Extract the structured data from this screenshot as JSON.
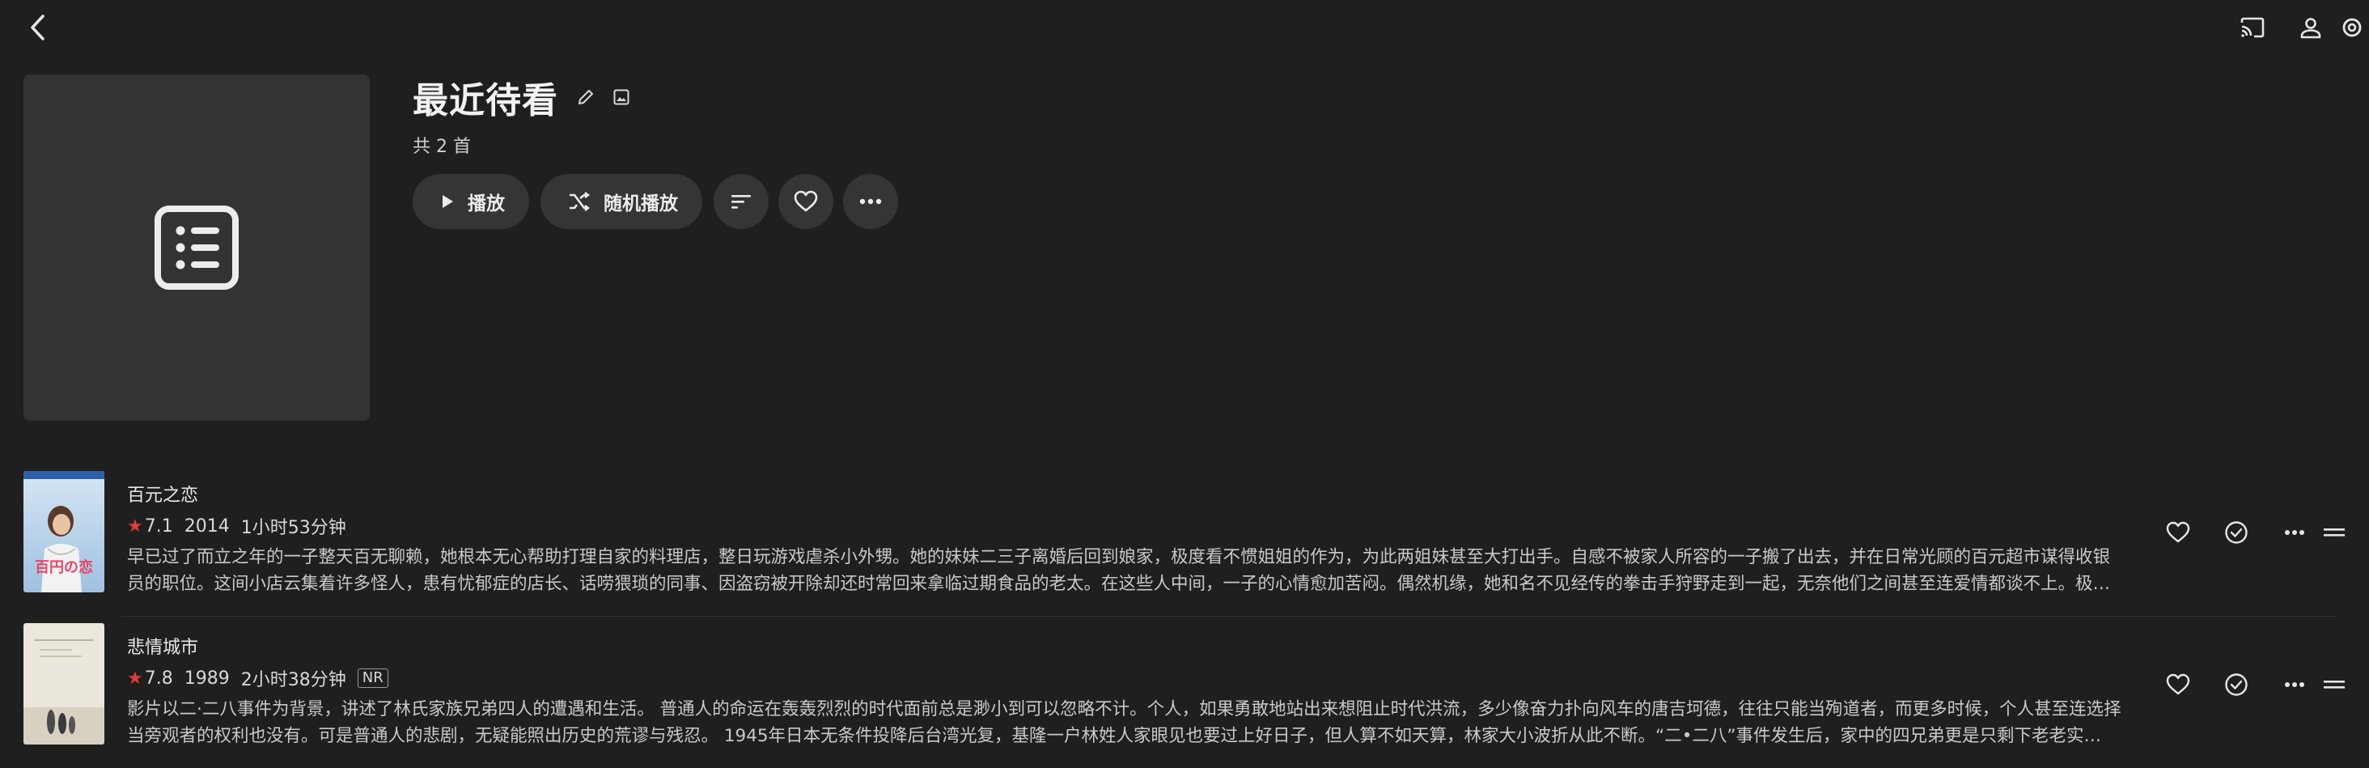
{
  "header": {
    "title": "最近待看",
    "count": "共 2 首"
  },
  "actions": {
    "play_label": "播放",
    "shuffle_label": "随机播放"
  },
  "items": [
    {
      "title": "百元之恋",
      "rating": "7.1",
      "year": "2014",
      "runtime": "1小时53分钟",
      "badge": "",
      "overview": "早已过了而立之年的一子整天百无聊赖，她根本无心帮助打理自家的料理店，整日玩游戏虐杀小外甥。她的妹妹二三子离婚后回到娘家，极度看不惯姐姐的作为，为此两姐妹甚至大打出手。自感不被家人所容的一子搬了出去，并在日常光顾的百元超市谋得收银员的职位。这间小店云集着许多怪人，患有忧郁症的店长、话唠猥琐的同事、因盗窃被开除却还时常回来拿临过期食品的老太。在这些人中间，一子的心情愈加苦闷。偶然机缘，她和名不见经传的拳击手狩野走到一起，无奈他们之间甚至连爱情都谈不上。极…",
      "poster_text": "百円の恋"
    },
    {
      "title": "悲情城市",
      "rating": "7.8",
      "year": "1989",
      "runtime": "2小时38分钟",
      "badge": "NR",
      "overview": "影片以二·二八事件为背景，讲述了林氏家族兄弟四人的遭遇和生活。 普通人的命运在轰轰烈烈的时代面前总是渺小到可以忽略不计。个人，如果勇敢地站出来想阻止时代洪流，多少像奋力扑向风车的唐吉坷德，往往只能当殉道者，而更多时候，个人甚至连选择当旁观者的权利也没有。可是普通人的悲剧，无疑能照出历史的荒谬与残忍。 1945年日本无条件投降后台湾光复，基隆一户林姓人家眼见也要过上好日子，但人算不如天算，林家大小波折从此不断。“二•二八”事件发生后，家中的四兄弟更是只剩下老老实…",
      "poster_text": ""
    }
  ],
  "colors": {
    "background": "#1f1f1f",
    "button": "#353535",
    "star": "#e03b3b"
  }
}
